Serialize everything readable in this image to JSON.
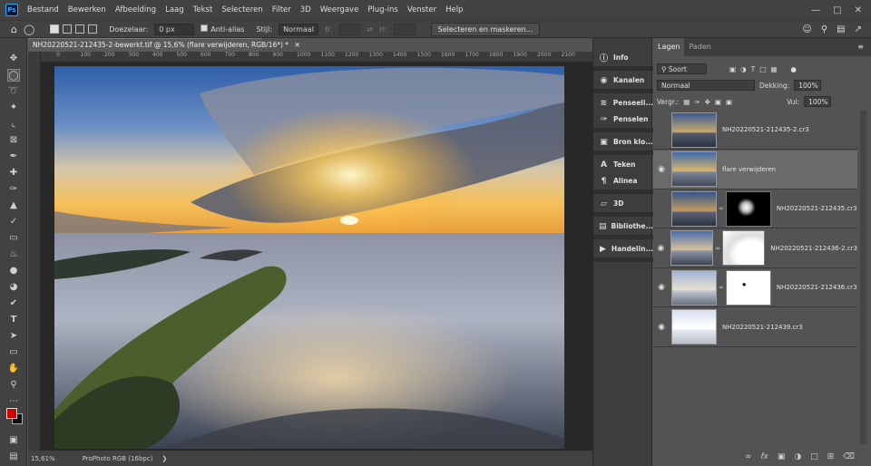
{
  "menu": [
    "Bestand",
    "Bewerken",
    "Afbeelding",
    "Laag",
    "Tekst",
    "Selecteren",
    "Filter",
    "3D",
    "Weergave",
    "Plug-ins",
    "Venster",
    "Help"
  ],
  "app_logo": "Ps",
  "options": {
    "feather_label": "Doezelaar:",
    "feather_value": "0 px",
    "antialias_label": "Anti-alias",
    "style_label": "Stijl:",
    "style_value": "Normaal",
    "width_label": "B:",
    "height_label": "H:",
    "select_mask_button": "Selecteren en maskeren..."
  },
  "document": {
    "tab_title": "NH20220521-212435-2-bewerkt.tif @ 15,6% (flare verwijderen, RGB/16*) *",
    "ruler_ticks": [
      "0",
      "100",
      "200",
      "300",
      "400",
      "500",
      "600",
      "700",
      "800",
      "900",
      "1000",
      "1100",
      "1200",
      "1300",
      "1400",
      "1500",
      "1600",
      "1700",
      "1800",
      "1900",
      "2000",
      "2100"
    ],
    "zoom": "15,61%",
    "profile": "ProPhoto RGB (16bpc)"
  },
  "collapsed_panels": [
    {
      "icon": "info-icon",
      "label": "Info"
    },
    {
      "icon": "channels-icon",
      "label": "Kanalen"
    },
    {
      "icon": "brush-settings-icon",
      "label": "Penseeli..."
    },
    {
      "icon": "brushes-icon",
      "label": "Penselen"
    },
    {
      "icon": "clone-source-icon",
      "label": "Bron klo..."
    },
    {
      "icon": "character-icon",
      "label": "Teken"
    },
    {
      "icon": "paragraph-icon",
      "label": "Alinea"
    },
    {
      "icon": "3d-icon",
      "label": "3D"
    },
    {
      "icon": "libraries-icon",
      "label": "Bibliothe..."
    },
    {
      "icon": "actions-icon",
      "label": "Handelin..."
    }
  ],
  "layers_panel": {
    "tabs": [
      "Lagen",
      "Paden"
    ],
    "filter_label": "Soort",
    "blend_mode": "Normaal",
    "opacity_label": "Dekking:",
    "opacity_value": "100%",
    "lock_label": "Vergr.:",
    "fill_label": "Vul:",
    "fill_value": "100%",
    "layers": [
      {
        "name": "NH20220521-212435-2.cr3",
        "visible": false,
        "selected": false,
        "mask": false
      },
      {
        "name": "flare verwijderen",
        "visible": true,
        "selected": true,
        "mask": false
      },
      {
        "name": "NH20220521-212435.cr3",
        "visible": false,
        "selected": false,
        "mask": true
      },
      {
        "name": "NH20220521-212436-2.cr3",
        "visible": true,
        "selected": false,
        "mask": true
      },
      {
        "name": "NH20220521-212436.cr3",
        "visible": true,
        "selected": false,
        "mask": true
      },
      {
        "name": "NH20220521-212439.cr3",
        "visible": true,
        "selected": false,
        "mask": false
      }
    ],
    "footer_icons": [
      "link-layers-icon",
      "fx-icon",
      "add-mask-icon",
      "adjustment-layer-icon",
      "group-icon",
      "new-layer-icon",
      "trash-icon"
    ]
  },
  "colors": {
    "foreground": "#d40000",
    "background": "#111111",
    "accent": "#31a8ff"
  }
}
